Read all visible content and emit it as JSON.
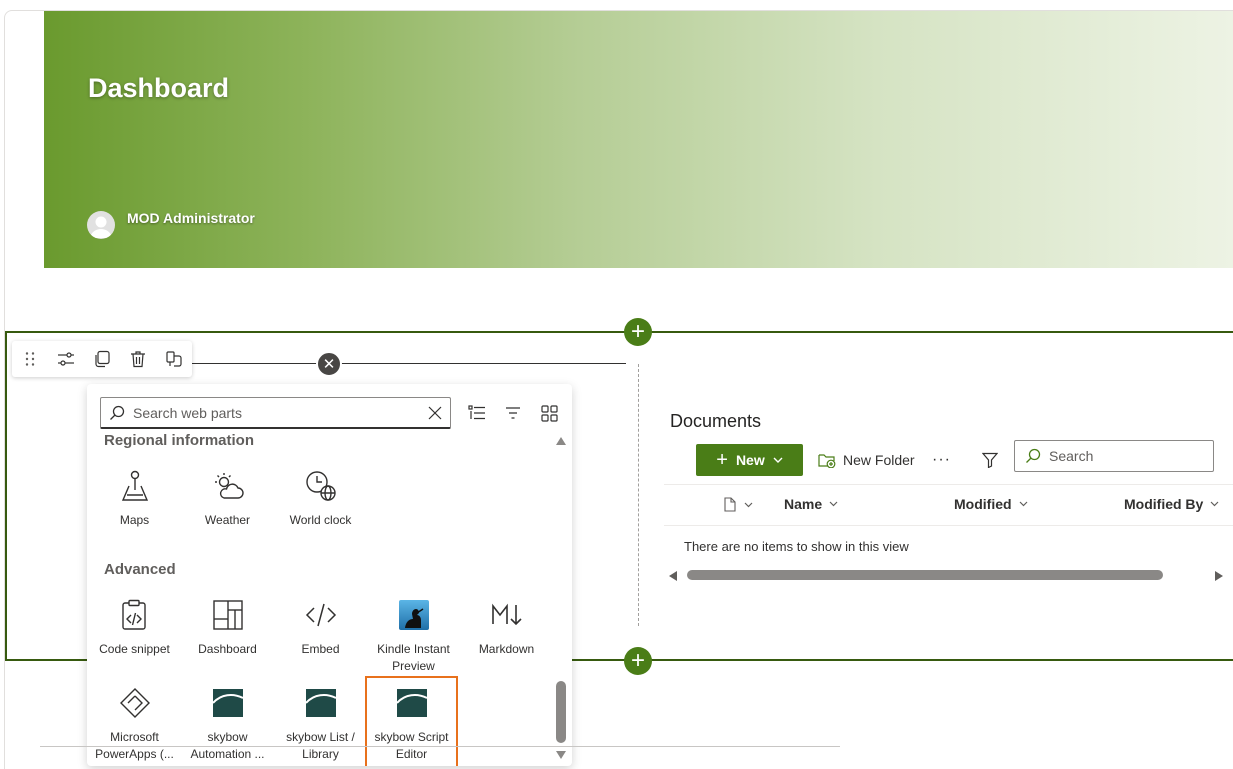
{
  "header": {
    "title": "Dashboard",
    "author": "MOD Administrator"
  },
  "toolbar": {
    "items": [
      "drag-handle-icon",
      "edit-properties-icon",
      "duplicate-icon",
      "delete-icon",
      "format-painter-icon"
    ]
  },
  "picker": {
    "search_placeholder": "Search web parts",
    "categories": [
      {
        "title": "Regional information",
        "items": [
          {
            "label": "Maps",
            "icon": "pin-icon"
          },
          {
            "label": "Weather",
            "icon": "weather-icon"
          },
          {
            "label": "World clock",
            "icon": "world-clock-icon"
          }
        ]
      },
      {
        "title": "Advanced",
        "items": [
          {
            "label": "Code snippet",
            "icon": "code-snippet-icon"
          },
          {
            "label": "Dashboard",
            "icon": "dashboard-icon"
          },
          {
            "label": "Embed",
            "icon": "embed-icon"
          },
          {
            "label": "Kindle Instant Preview",
            "icon": "kindle-icon"
          },
          {
            "label": "Markdown",
            "icon": "markdown-icon"
          },
          {
            "label": "Microsoft PowerApps (...",
            "icon": "powerapps-icon"
          },
          {
            "label": "skybow Automation ...",
            "icon": "skybow-icon"
          },
          {
            "label": "skybow List / Library",
            "icon": "skybow-icon"
          },
          {
            "label": "skybow Script Editor",
            "icon": "skybow-icon"
          }
        ]
      }
    ]
  },
  "documents": {
    "title": "Documents",
    "new_label": "New",
    "new_folder_label": "New Folder",
    "search_placeholder": "Search",
    "columns": [
      "Name",
      "Modified",
      "Modified By"
    ],
    "empty_message": "There are no items to show in this view"
  },
  "colors": {
    "accent": "#4a7d17",
    "section_border": "#375a0f",
    "selected_outline": "#e8711c"
  }
}
